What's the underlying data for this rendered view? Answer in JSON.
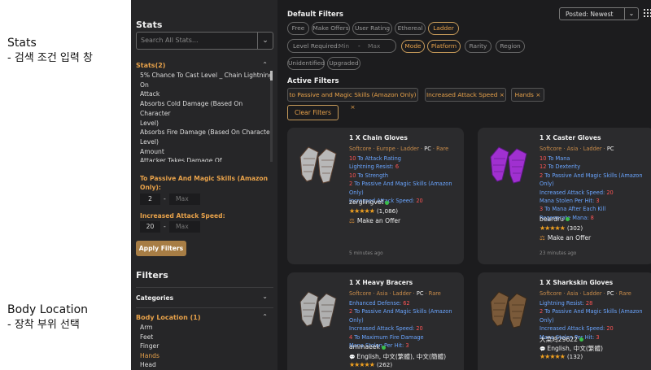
{
  "annotations": [
    {
      "title": "Stats",
      "subtitle": " - 검색 조건 입력 창"
    },
    {
      "title": "Body Location",
      "subtitle": " - 장착 부위 선택"
    }
  ],
  "sidebar": {
    "title": "Stats",
    "search_placeholder": "Search All Stats...",
    "stats_header": "Stats(2)",
    "stats_list": [
      "5% Chance To Cast Level _ Chain Lightning On",
      "Attack",
      "Absorbs Cold Damage (Based On Character",
      "Level)",
      "Absorbs Fire Damage (Based On Character",
      "Level)",
      "Amount",
      "Attacker Takes Damage Of",
      "Attacker Takes Damage Of (Based On",
      "Character Level)"
    ],
    "range1": {
      "label": "To Passive And Magic Skills (Amazon Only):",
      "min": "2",
      "max_placeholder": "Max"
    },
    "range2": {
      "label": "Increased Attack Speed:",
      "min": "20",
      "max_placeholder": "Max"
    },
    "apply_label": "Apply Filters",
    "filters_title": "Filters",
    "categories_label": "Categories",
    "body_location_label": "Body Location (1)",
    "body_locations": [
      "Arm",
      "Feet",
      "Finger",
      "Hands",
      "Head"
    ],
    "selected_body_location": "Hands"
  },
  "main": {
    "default_filters_title": "Default Filters",
    "chips_row1": [
      {
        "label": "Free",
        "active": false
      },
      {
        "label": "Make Offers",
        "active": false
      },
      {
        "label": "User Rating",
        "active": false
      },
      {
        "label": "Ethereal",
        "active": false
      },
      {
        "label": "Ladder",
        "active": true
      }
    ],
    "level_required": {
      "label": "Level Required:",
      "min_placeholder": "Min",
      "max_placeholder": "Max"
    },
    "chips_row2": [
      {
        "label": "Mode",
        "active": true
      },
      {
        "label": "Platform",
        "active": true
      },
      {
        "label": "Rarity",
        "active": false
      },
      {
        "label": "Region",
        "active": false
      }
    ],
    "chips_row3": [
      {
        "label": "Unidentified",
        "active": false
      },
      {
        "label": "Upgraded",
        "active": false
      }
    ],
    "active_filters_title": "Active Filters",
    "active_filters": [
      "to Passive and Magic Skills (Amazon Only) ×",
      "Increased Attack Speed ×",
      "Hands ×"
    ],
    "clear_label": "Clear Filters",
    "sort_value": "Posted: Newest"
  },
  "listings": [
    {
      "title": "1 X Chain Gloves",
      "meta": [
        "Softcore",
        "Europe",
        "Ladder",
        "PC",
        "Rare"
      ],
      "mods": [
        {
          "n": "10",
          "t": " To Attack Rating"
        },
        {
          "n": "",
          "t": "Lightning Resist: ",
          "n2": "6"
        },
        {
          "n": "10",
          "t": " To Strength"
        },
        {
          "n": "2",
          "t": " To Passive And Magic Skills (Amazon Only)"
        },
        {
          "n": "",
          "t": "Increased Attack Speed: ",
          "n2": "20"
        }
      ],
      "seller": "zerglingvet",
      "rating_count": "(1,086)",
      "offer": "Make an Offer",
      "time": "5 minutes ago"
    },
    {
      "title": "1 X Caster Gloves",
      "meta": [
        "Softcore",
        "Asia",
        "Ladder",
        "PC"
      ],
      "mods": [
        {
          "n": "10",
          "t": " To Mana"
        },
        {
          "n": "12",
          "t": " To Dexterity"
        },
        {
          "n": "2",
          "t": " To Passive And Magic Skills (Amazon Only)"
        },
        {
          "n": "",
          "t": "Increased Attack Speed: ",
          "n2": "20"
        },
        {
          "n": "",
          "t": "Mana Stolen Per Hit: ",
          "n2": "3"
        },
        {
          "n": "3",
          "t": " To Mana After Each Kill"
        },
        {
          "n": "",
          "t": "Regenerate Mana: ",
          "n2": "8"
        }
      ],
      "seller": "beardru",
      "rating_count": "(302)",
      "offer": "Make an Offer",
      "time": "23 minutes ago"
    },
    {
      "title": "1 X Heavy Bracers",
      "meta": [
        "Softcore",
        "Asia",
        "Ladder",
        "PC",
        "Rare"
      ],
      "mods": [
        {
          "n": "",
          "t": "Enhanced Defense: ",
          "n2": "62"
        },
        {
          "n": "2",
          "t": " To Passive And Magic Skills (Amazon Only)"
        },
        {
          "n": "",
          "t": "Increased Attack Speed: ",
          "n2": "20"
        },
        {
          "n": "4",
          "t": " To Maximum Fire Damage"
        },
        {
          "n": "",
          "t": "Mana Stolen Per Hit: ",
          "n2": "3"
        }
      ],
      "seller": "ammaeek",
      "languages": "English, 中文(繁體), 中文(簡體)",
      "rating_count": "(262)"
    },
    {
      "title": "1 X Sharkskin Gloves",
      "meta": [
        "Softcore",
        "Asia",
        "Ladder",
        "PC",
        "Rare"
      ],
      "mods": [
        {
          "n": "",
          "t": "Lightning Resist: ",
          "n2": "28"
        },
        {
          "n": "2",
          "t": " To Passive And Magic Skills (Amazon Only)"
        },
        {
          "n": "",
          "t": "Increased Attack Speed: ",
          "n2": "20"
        },
        {
          "n": "",
          "t": "Mana Stolen Per Hit: ",
          "n2": "3"
        }
      ],
      "seller": "大菜鸡29622",
      "languages": "English, 中文(繁體)",
      "rating_count": "(132)"
    }
  ],
  "colors": {
    "accent": "#e8a24a",
    "mod_blue": "#6aa5ff",
    "mod_red": "#ff5555",
    "star": "#f0a020"
  }
}
